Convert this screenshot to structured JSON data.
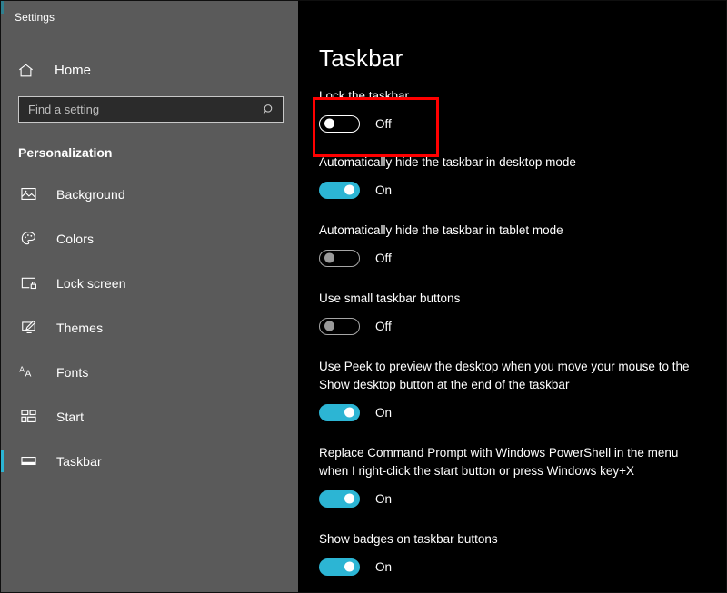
{
  "window": {
    "title": "Settings"
  },
  "sidebar": {
    "home": {
      "label": "Home",
      "icon": "home-icon"
    },
    "search": {
      "placeholder": "Find a setting",
      "value": "",
      "icon": "search-icon"
    },
    "section_heading": "Personalization",
    "accent_color": "#2cb5d4",
    "background_color": "#5a5a5a",
    "items": [
      {
        "label": "Background",
        "icon": "picture-icon",
        "selected": false
      },
      {
        "label": "Colors",
        "icon": "palette-icon",
        "selected": false
      },
      {
        "label": "Lock screen",
        "icon": "lock-screen-icon",
        "selected": false
      },
      {
        "label": "Themes",
        "icon": "themes-icon",
        "selected": false
      },
      {
        "label": "Fonts",
        "icon": "fonts-icon",
        "selected": false
      },
      {
        "label": "Start",
        "icon": "start-tiles-icon",
        "selected": false
      },
      {
        "label": "Taskbar",
        "icon": "taskbar-icon",
        "selected": true
      }
    ]
  },
  "main": {
    "page_title": "Taskbar",
    "background_color": "#000000",
    "highlight": {
      "color": "#ff0000",
      "target": "Lock the taskbar"
    },
    "settings": [
      {
        "label": "Lock the taskbar",
        "state": "Off",
        "on": false,
        "highlighted": true
      },
      {
        "label": "Automatically hide the taskbar in desktop mode",
        "state": "On",
        "on": true,
        "highlighted": false
      },
      {
        "label": "Automatically hide the taskbar in tablet mode",
        "state": "Off",
        "on": false,
        "highlighted": false
      },
      {
        "label": "Use small taskbar buttons",
        "state": "Off",
        "on": false,
        "highlighted": false
      },
      {
        "label": "Use Peek to preview the desktop when you move your mouse to the Show desktop button at the end of the taskbar",
        "state": "On",
        "on": true,
        "highlighted": false
      },
      {
        "label": "Replace Command Prompt with Windows PowerShell in the menu when I right-click the start button or press Windows key+X",
        "state": "On",
        "on": true,
        "highlighted": false
      },
      {
        "label": "Show badges on taskbar buttons",
        "state": "On",
        "on": true,
        "highlighted": false
      }
    ]
  }
}
